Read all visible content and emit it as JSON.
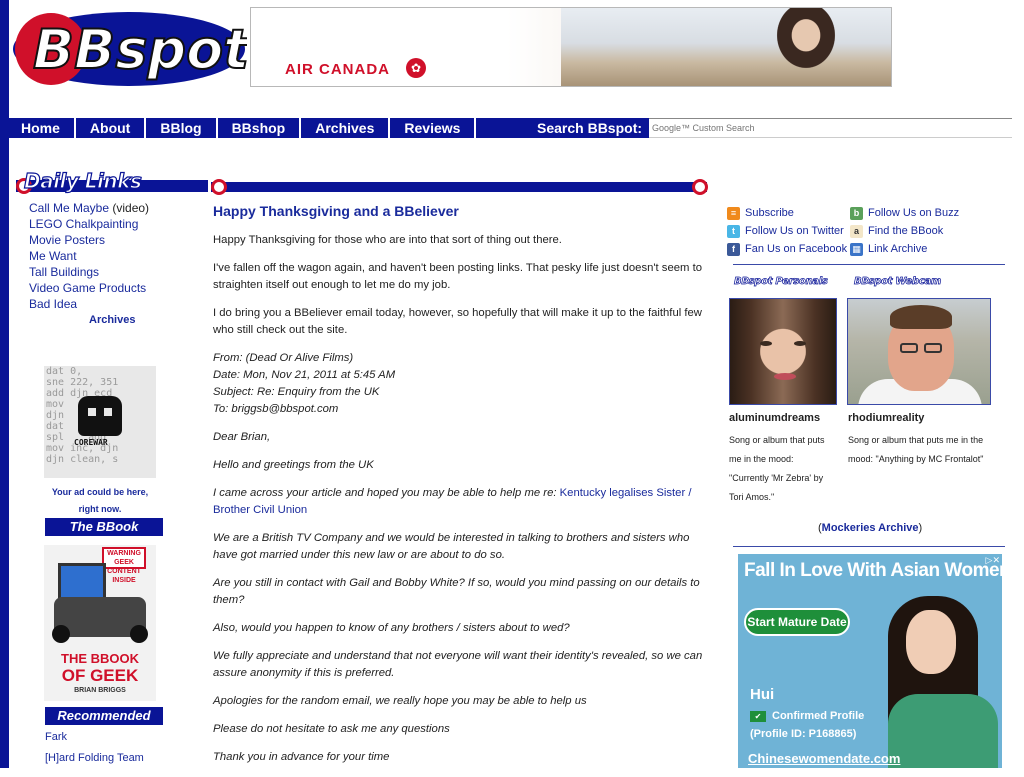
{
  "header": {
    "logo_text": "BBspot",
    "ad_text": "AIR CANADA"
  },
  "nav": {
    "items": [
      "Home",
      "About",
      "BBlog",
      "BBshop",
      "Archives",
      "Reviews"
    ],
    "search_label": "Search BBspot:",
    "search_placeholder": "Google™ Custom Search"
  },
  "left": {
    "daily_links_title": "Daily Links",
    "links": [
      {
        "text": "Call Me Maybe",
        "extra": " (video)"
      },
      {
        "text": "LEGO Chalkpainting",
        "extra": ""
      },
      {
        "text": "Movie Posters",
        "extra": ""
      },
      {
        "text": "Me Want",
        "extra": ""
      },
      {
        "text": "Tall Buildings",
        "extra": ""
      },
      {
        "text": "Video Game Products",
        "extra": ""
      },
      {
        "text": "Bad Idea",
        "extra": ""
      }
    ],
    "archives_link": "Archives",
    "corewar_label": "COREWAR",
    "corewar_code": "dat 0,\nsne 222, 351\nadd djn ecd\nmov    cal\ndjn    snr\ndat     mov\nspl    add\nmov inc, djn\ndjn clean, s",
    "ad_note_line1": "Your ad could be here,",
    "ad_note_line2": "right now.",
    "bbook_header": "The BBook",
    "bbook_warning": "WARNING GEEK CONTENT INSIDE",
    "bbook_title_top": "THE BBOOK",
    "bbook_title_bottom": "OF GEEK",
    "bbook_author": "BRIAN BRIGGS",
    "recommended_header": "Recommended",
    "recommended": [
      "Fark",
      "[H]ard Folding Team"
    ]
  },
  "post": {
    "title": "Happy Thanksgiving and a BBeliever",
    "p1": "Happy Thanksgiving for those who are into that sort of thing out there.",
    "p2": "I've fallen off the wagon again, and haven't been posting links. That pesky life just doesn't seem to straighten itself out enough to let me do my job.",
    "p3": "I do bring you a BBeliever email today, however, so hopefully that will make it up to the faithful few who still check out the site.",
    "from": "From: (Dead Or Alive Films)",
    "date": "Date: Mon, Nov 21, 2011 at 5:45 AM",
    "subject": "Subject: Re: Enquiry from the UK",
    "to": "To: briggsb@bbspot.com",
    "e1": "Dear Brian,",
    "e2": "Hello and greetings from the UK",
    "e3_before": "I came across your article and hoped you may be able to help me re: ",
    "e3_link": "Kentucky legalises Sister / Brother Civil Union",
    "e4": "We are a British TV Company and we would be interested in talking to brothers and sisters who have got married under this new law or are about to do so.",
    "e5": "Are you still in contact with Gail and Bobby White? If so, would you mind passing on our details to them?",
    "e6": "Also, would you happen to know of any brothers / sisters about to wed?",
    "e7": "We fully appreciate and understand that not everyone will want their identity's revealed, so we can assure anonymity if this is preferred.",
    "e8": "Apologies for the random email, we really hope you may be able to help us",
    "e9": "Please do not hesitate to ask me any questions",
    "e10": "Thank you in advance for your time"
  },
  "right": {
    "links_col1": [
      "Subscribe",
      "Follow Us on Twitter",
      "Fan Us on Facebook"
    ],
    "links_col2": [
      "Follow Us on Buzz",
      "Find the BBook",
      "Link Archive"
    ],
    "personals_header": "BBspot Personals",
    "webcam_header": "BBspot Webcam",
    "user1": {
      "name": "aluminumdreams",
      "desc1": "Song or album that puts",
      "desc2": "me in the mood:",
      "desc3": "\"Currently 'Mr Zebra' by",
      "desc4": "Tori Amos.\""
    },
    "user2": {
      "name": "rhodiumreality",
      "desc1": "Song or album that puts me in the",
      "desc2": "mood: \"Anything by MC Frontalot\""
    },
    "mock_open": "(",
    "mock_link": "Mockeries Archive",
    "mock_close": ")",
    "ad": {
      "title": "Fall In Love With Asian Women",
      "button": "Start Mature Date",
      "name": "Hui",
      "confirmed": "Confirmed Profile",
      "profile_id": "(Profile ID: P168865)",
      "domain": "Chinesewomendate.com"
    }
  }
}
